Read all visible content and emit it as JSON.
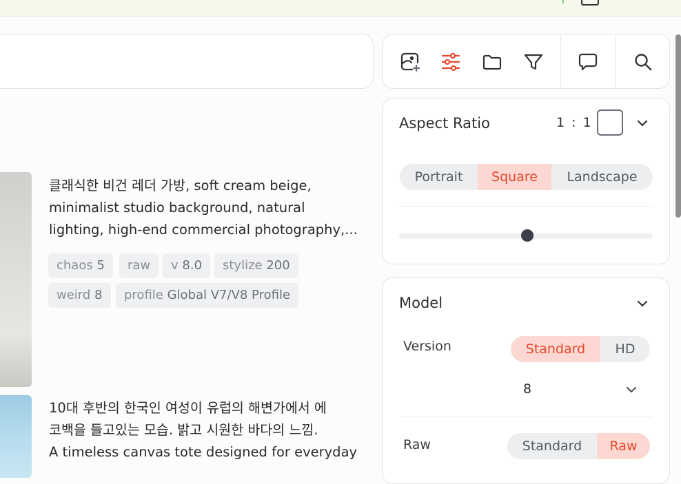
{
  "prompts": [
    {
      "lines": [
        "클래식한 비건 레더 가방, soft cream beige,",
        "minimalist studio background, natural",
        "lighting, high-end commercial photography,..."
      ],
      "tags": [
        {
          "key": "chaos",
          "value": "5"
        },
        {
          "key": "raw",
          "value": ""
        },
        {
          "key": "v",
          "value": "8.0"
        },
        {
          "key": "stylize",
          "value": "200"
        },
        {
          "key": "weird",
          "value": "8"
        },
        {
          "key": "profile",
          "value": "Global V7/V8 Profile"
        }
      ]
    },
    {
      "lines": [
        "10대 후반의 한국인 여성이 유럽의 해변가에서 에",
        "코백을 들고있는 모습. 밝고 시원한 바다의 느낌.",
        "A timeless canvas tote designed for everyday"
      ]
    }
  ],
  "toolbar": {
    "icons": [
      "image-add-icon",
      "sliders-icon",
      "folder-icon",
      "filter-icon",
      "chat-icon",
      "search-icon"
    ],
    "active_color": "#e4472d"
  },
  "aspect_ratio": {
    "title": "Aspect Ratio",
    "value": "1 : 1",
    "options": [
      "Portrait",
      "Square",
      "Landscape"
    ],
    "selected": "Square"
  },
  "model": {
    "title": "Model",
    "version_label": "Version",
    "version_options": [
      "Standard",
      "HD"
    ],
    "version_selected": "Standard",
    "version_number": "8",
    "raw_label": "Raw",
    "raw_options": [
      "Standard",
      "Raw"
    ],
    "raw_selected": "Raw"
  },
  "colors": {
    "accent": "#e4472d",
    "accent_bg": "#fdd8d2",
    "chip_bg": "#eff0f2"
  }
}
